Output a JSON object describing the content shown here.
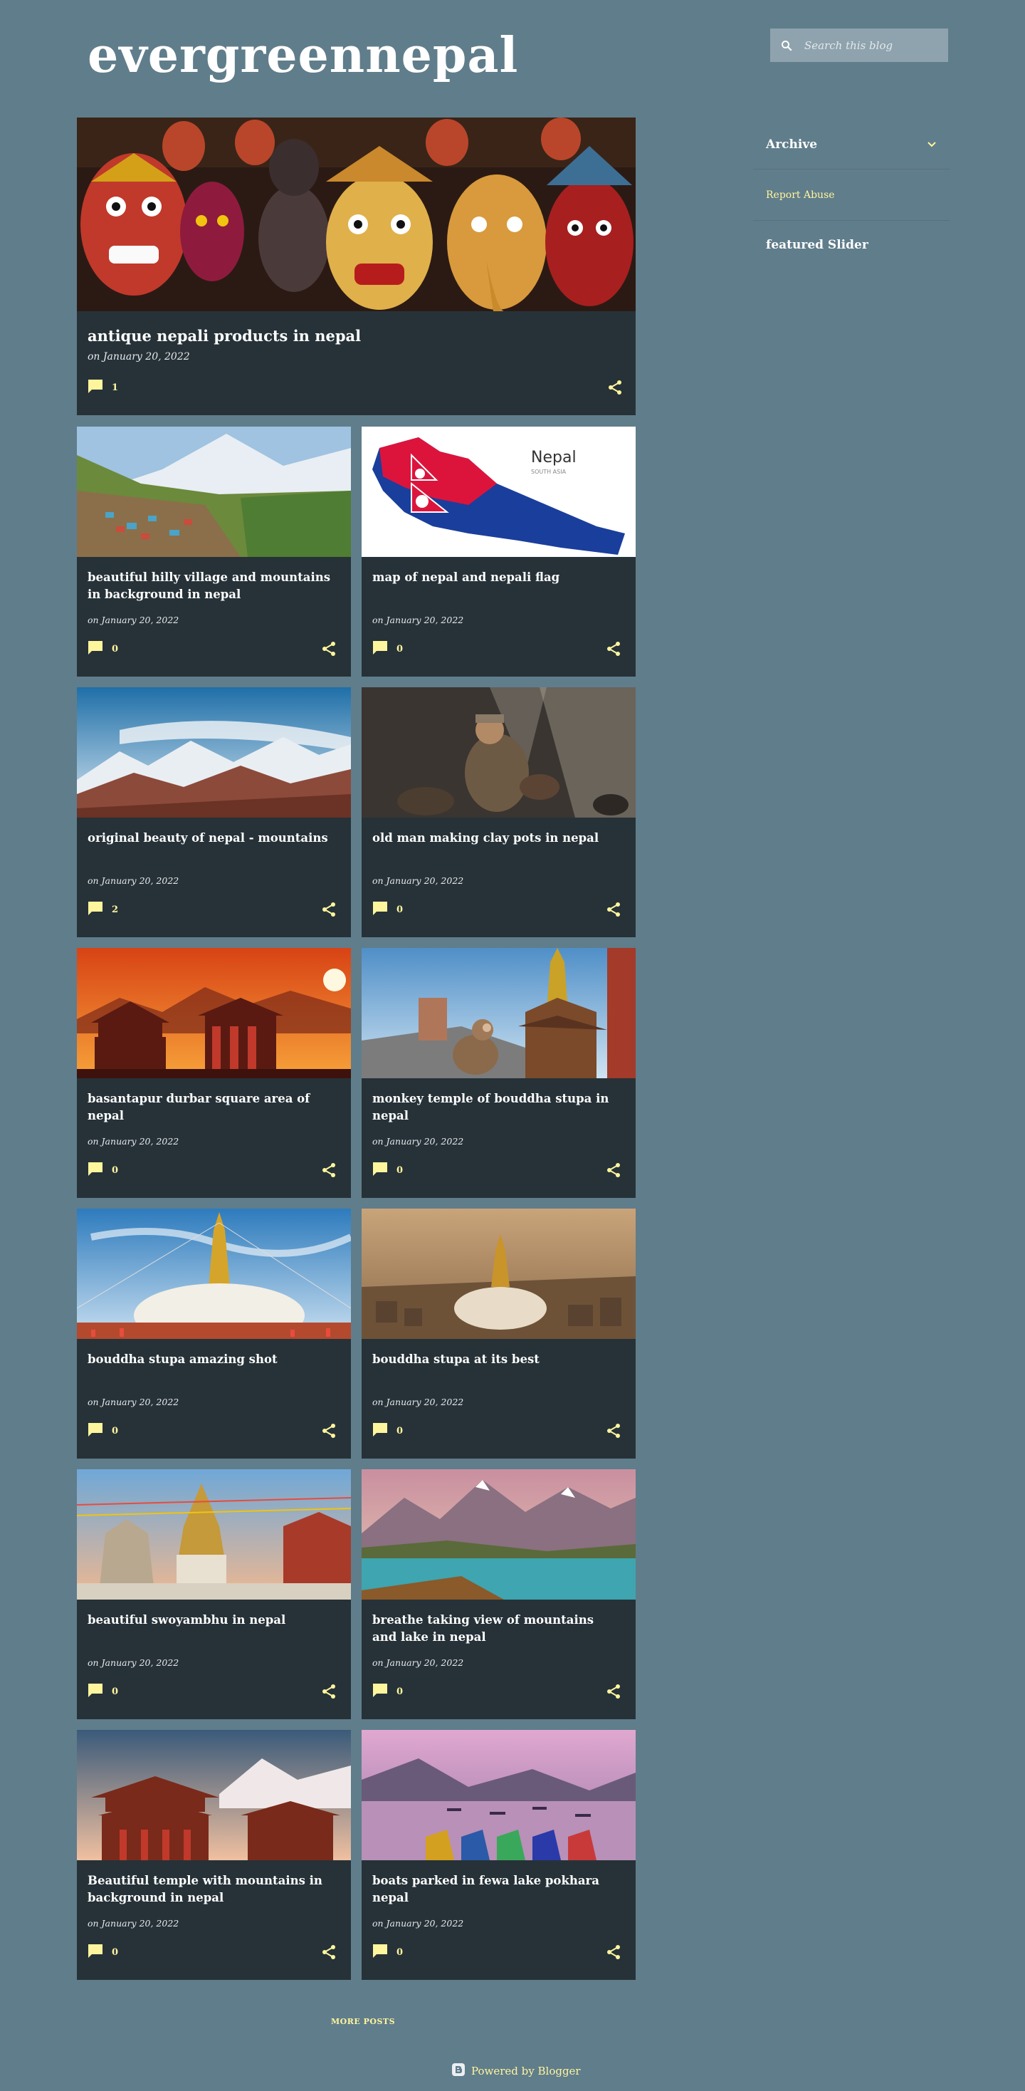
{
  "blog": {
    "title": "evergreennepal"
  },
  "search": {
    "placeholder": "Search this blog"
  },
  "sidebar": {
    "archive_label": "Archive",
    "report_abuse_label": "Report Abuse",
    "featured_slider_label": "featured Slider"
  },
  "featured_post": {
    "title": "antique nepali products in nepal",
    "date": "on January 20, 2022",
    "comments": "1"
  },
  "posts": [
    {
      "title": "beautiful hilly village and mountains in background in nepal",
      "date": "on January 20, 2022",
      "comments": "0",
      "image": "mountain-village"
    },
    {
      "title": "map of nepal and nepali flag",
      "date": "on January 20, 2022",
      "comments": "0",
      "image": "nepal-map"
    },
    {
      "title": "original beauty of nepal - mountains",
      "date": "on January 20, 2022",
      "comments": "2",
      "image": "snowy-mountains"
    },
    {
      "title": "old man making clay pots in nepal",
      "date": "on January 20, 2022",
      "comments": "0",
      "image": "potter"
    },
    {
      "title": "basantapur durbar square area of nepal",
      "date": "on January 20, 2022",
      "comments": "0",
      "image": "durbar-sunset"
    },
    {
      "title": "monkey temple of bouddha stupa in nepal",
      "date": "on January 20, 2022",
      "comments": "0",
      "image": "monkey-temple"
    },
    {
      "title": "bouddha stupa amazing shot",
      "date": "on January 20, 2022",
      "comments": "0",
      "image": "stupa-blue"
    },
    {
      "title": "bouddha stupa at its best",
      "date": "on January 20, 2022",
      "comments": "0",
      "image": "stupa-haze"
    },
    {
      "title": "beautiful swoyambhu in nepal",
      "date": "on January 20, 2022",
      "comments": "0",
      "image": "swoyambhu"
    },
    {
      "title": "breathe taking view of mountains and lake in nepal",
      "date": "on January 20, 2022",
      "comments": "0",
      "image": "mountain-lake"
    },
    {
      "title": "Beautiful temple with mountains in background in nepal",
      "date": "on January 20, 2022",
      "comments": "0",
      "image": "temple-mountains"
    },
    {
      "title": "boats parked in fewa lake pokhara nepal",
      "date": "on January 20, 2022",
      "comments": "0",
      "image": "fewa-boats"
    }
  ],
  "map_text": {
    "country": "Nepal",
    "region": "SOUTH ASIA"
  },
  "more_posts_label": "MORE POSTS",
  "footer": {
    "powered_by": "Powered by Blogger"
  },
  "colors": {
    "background": "#607d8b",
    "card": "#263238",
    "accent": "#fff59d"
  }
}
